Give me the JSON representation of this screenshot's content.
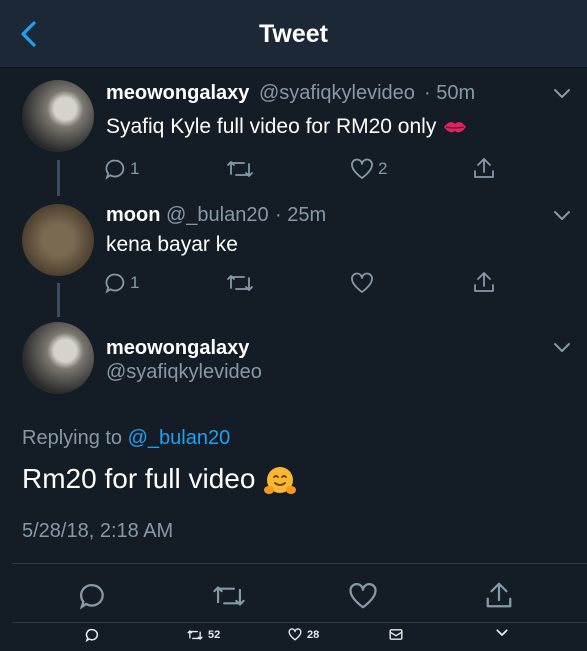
{
  "header": {
    "title": "Tweet",
    "back_icon": "chevron-left-icon",
    "accent": "#1da1f2"
  },
  "tweets": [
    {
      "name": "meowongalaxy",
      "handle": "@syafiqkylevideo",
      "time": "· 50m",
      "text": "Syafiq Kyle full video for RM20 only",
      "text_emoji": "kiss-mark-emoji",
      "reply_count": "1",
      "retweet_count": "",
      "like_count": "2"
    },
    {
      "name": "moon",
      "handle": "@_bulan20",
      "time": "· 25m",
      "text": "kena bayar ke",
      "reply_count": "1",
      "retweet_count": "",
      "like_count": ""
    }
  ],
  "main_tweet": {
    "name": "meowongalaxy",
    "handle": "@syafiqkylevideo",
    "replying_prefix": "Replying to",
    "replying_to": "@_bulan20",
    "text": "Rm20 for full video",
    "text_emoji": "hugging-face-emoji",
    "timestamp": "5/28/18, 2:18 AM"
  },
  "bottom_bar": {
    "retweet_count": "52",
    "like_count": "28"
  }
}
